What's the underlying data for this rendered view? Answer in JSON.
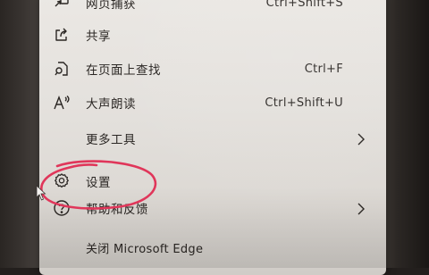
{
  "menu": {
    "items": [
      {
        "label": "网页捕获",
        "shortcut": "Ctrl+Shift+S",
        "icon": "web-capture-icon"
      },
      {
        "label": "共享",
        "shortcut": "",
        "icon": "share-icon"
      },
      {
        "label": "在页面上查找",
        "shortcut": "Ctrl+F",
        "icon": "find-on-page-icon"
      },
      {
        "label": "大声朗读",
        "shortcut": "Ctrl+Shift+U",
        "icon": "read-aloud-icon"
      },
      {
        "label": "更多工具",
        "shortcut": "",
        "icon": "",
        "submenu": true
      },
      {
        "label": "设置",
        "shortcut": "",
        "icon": "gear-icon"
      },
      {
        "label": "帮助和反馈",
        "shortcut": "",
        "icon": "help-icon",
        "submenu": true
      },
      {
        "label": "关闭 Microsoft Edge",
        "shortcut": "",
        "icon": ""
      }
    ]
  },
  "colors": {
    "menu_background": "#e6e3df",
    "text": "#2a2623",
    "highlight_circle": "#e0365a",
    "surrounding": "#231f1d"
  }
}
